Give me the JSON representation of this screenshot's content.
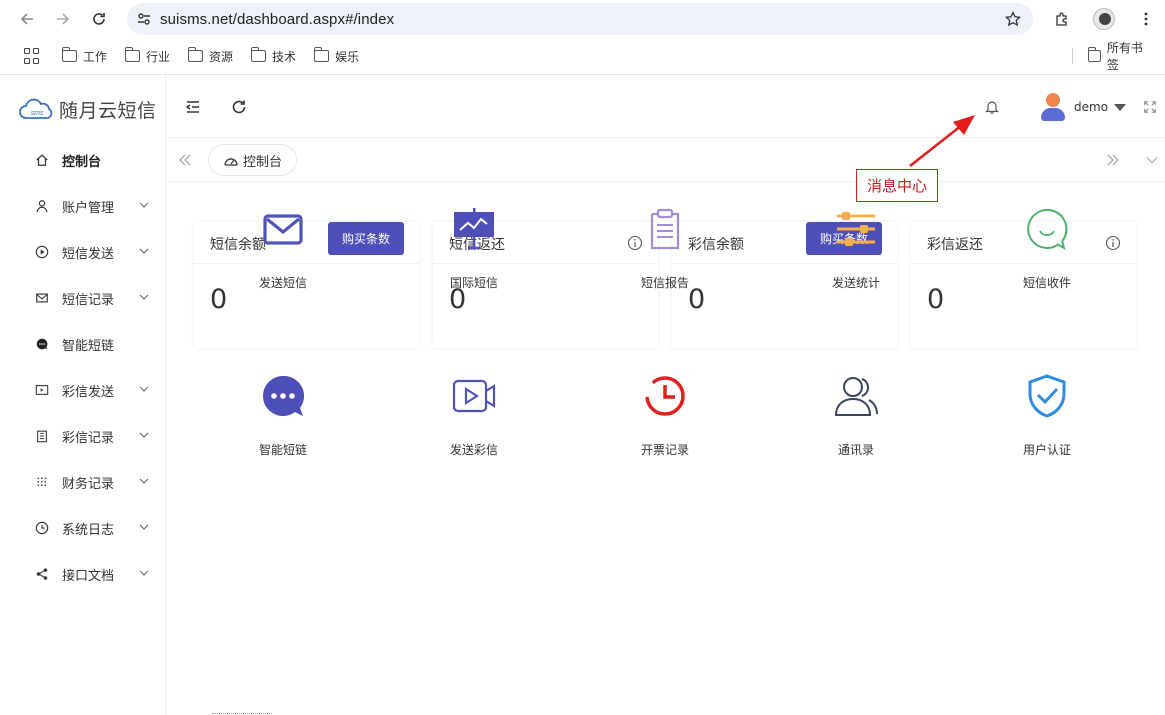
{
  "browser": {
    "url": "suisms.net/dashboard.aspx#/index",
    "bookmarks": [
      "工作",
      "行业",
      "资源",
      "技术",
      "娱乐"
    ],
    "all_bookmarks": "所有书签"
  },
  "app": {
    "logo_text": "随月云短信",
    "logo_badge": "sms",
    "user_name": "demo"
  },
  "sidebar": {
    "items": [
      {
        "label": "控制台",
        "icon": "home-icon",
        "expandable": false,
        "active": true
      },
      {
        "label": "账户管理",
        "icon": "user-icon",
        "expandable": true,
        "active": false
      },
      {
        "label": "短信发送",
        "icon": "play-circle-icon",
        "expandable": true,
        "active": false
      },
      {
        "label": "短信记录",
        "icon": "mail-icon",
        "expandable": true,
        "active": false
      },
      {
        "label": "智能短链",
        "icon": "chat-bubble-icon",
        "expandable": false,
        "active": false
      },
      {
        "label": "彩信发送",
        "icon": "video-icon",
        "expandable": true,
        "active": false
      },
      {
        "label": "彩信记录",
        "icon": "clipboard-icon",
        "expandable": true,
        "active": false
      },
      {
        "label": "财务记录",
        "icon": "grid-dots-icon",
        "expandable": true,
        "active": false
      },
      {
        "label": "系统日志",
        "icon": "clock-icon",
        "expandable": true,
        "active": false
      },
      {
        "label": "接口文档",
        "icon": "share-icon",
        "expandable": true,
        "active": false
      }
    ]
  },
  "tabs": [
    {
      "label": "控制台",
      "icon": "dashboard-icon"
    }
  ],
  "cards": [
    {
      "title": "短信余额",
      "value": "0",
      "button": "购买条数"
    },
    {
      "title": "短信返还",
      "value": "0",
      "button": ""
    },
    {
      "title": "彩信余额",
      "value": "0",
      "button": "购买条数"
    },
    {
      "title": "彩信返还",
      "value": "0",
      "button": ""
    }
  ],
  "shortcuts": [
    {
      "label": "发送短信",
      "icon": "envelope-icon",
      "color": "#4e55b5"
    },
    {
      "label": "国际短信",
      "icon": "presentation-icon",
      "color": "#4e4fb8"
    },
    {
      "label": "短信报告",
      "icon": "clipboard-report-icon",
      "color": "#a58ad6"
    },
    {
      "label": "发送统计",
      "icon": "sliders-icon",
      "color": "#f5b04a"
    },
    {
      "label": "短信收件",
      "icon": "chat-smile-icon",
      "color": "#4cb06a"
    },
    {
      "label": "智能短链",
      "icon": "chat-dots-icon",
      "color": "#4e4fb8"
    },
    {
      "label": "发送彩信",
      "icon": "video-camera-icon",
      "color": "#4e55b5"
    },
    {
      "label": "开票记录",
      "icon": "alarm-clock-icon",
      "color": "#e0201b"
    },
    {
      "label": "通讯录",
      "icon": "contacts-icon",
      "color": "#3c4560"
    },
    {
      "label": "用户认证",
      "icon": "shield-check-icon",
      "color": "#2f8be0"
    }
  ],
  "annotation": {
    "label": "消息中心"
  }
}
